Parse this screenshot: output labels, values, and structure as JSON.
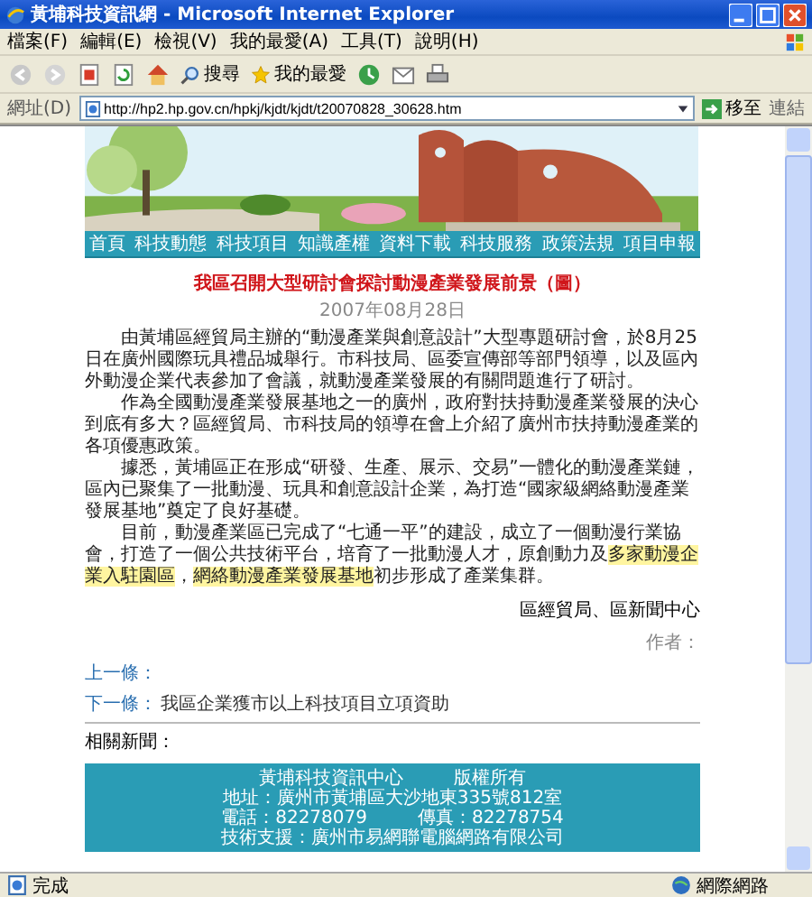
{
  "window": {
    "title": "黃埔科技資訊網 - Microsoft Internet Explorer"
  },
  "menu": [
    "檔案(F)",
    "編輯(E)",
    "檢視(V)",
    "我的最愛(A)",
    "工具(T)",
    "說明(H)"
  ],
  "toolbar": [
    {
      "kind": "back"
    },
    {
      "kind": "forward"
    },
    {
      "kind": "stop"
    },
    {
      "kind": "refresh"
    },
    {
      "kind": "home"
    },
    {
      "kind": "search",
      "label": "搜尋"
    },
    {
      "kind": "favorites",
      "label": "我的最愛"
    },
    {
      "kind": "history"
    },
    {
      "kind": "mail"
    },
    {
      "kind": "print"
    }
  ],
  "address": {
    "label": "網址(D)",
    "value": "http://hp2.hp.gov.cn/hpkj/kjdt/kjdt/t20070828_30628.htm",
    "go": "移至",
    "links": "連結"
  },
  "banner": {
    "kind": "picture"
  },
  "nav": [
    "首頁",
    "科技動態",
    "科技項目",
    "知識產權",
    "資料下載",
    "科技服務",
    "政策法規",
    "項目申報"
  ],
  "article": {
    "title": "我區召開大型研討會探討動漫產業發展前景（圖）",
    "date": "2007年08月28日",
    "paragraphs": [
      {
        "segments": [
          {
            "text": "由黃埔區經貿局主辦的“動漫產業與創意設計”大型專題研討會，於8月25日在廣州國際玩具禮品城舉行。市科技局、區委宣傳部等部門領導，以及區內外動漫企業代表參加了會議，就動漫產業發展的有關問題進行了研討。",
            "highlighted": false
          }
        ]
      },
      {
        "segments": [
          {
            "text": "作為全國動漫產業發展基地之一的廣州，政府對扶持動漫產業發展的決心到底有多大？區經貿局、市科技局的領導在會上介紹了廣州市扶持動漫產業的各項優惠政策。",
            "highlighted": false
          }
        ]
      },
      {
        "segments": [
          {
            "text": "據悉，黃埔區正在形成“研發、生產、展示、交易”一體化的動漫產業鏈，區內已聚集了一批動漫、玩具和創意設計企業，為打造“國家級網絡動漫產業發展基地”奠定了良好基礎。",
            "highlighted": false
          }
        ]
      },
      {
        "segments": [
          {
            "text": "目前，動漫產業區已完成了“七通一平”的建設，成立了一個動漫行業協會，打造了一個公共技術平台，培育了一批動漫人才，原創動力及",
            "highlighted": false
          },
          {
            "text": "多家動漫企業入駐園區",
            "highlighted": true
          },
          {
            "text": "，",
            "highlighted": false
          },
          {
            "text": "網絡動漫產業發展基地",
            "highlighted": true
          },
          {
            "text": "初步形成了產業集群。",
            "highlighted": false
          }
        ]
      }
    ],
    "source": "區經貿局、區新聞中心",
    "author": "作者：",
    "prev": {
      "label": "上一條："
    },
    "next": {
      "label": "下一條：",
      "title": "我區企業獲市以上科技項目立項資助"
    },
    "related": "相關新聞："
  },
  "footer": [
    [
      "黃埔科技資訊中心",
      "版權所有"
    ],
    [
      "地址：廣州市黃埔區大沙地東335號812室"
    ],
    [
      "電話：82278079",
      "傳真：82278754"
    ],
    [
      "技術支援：廣州市易網聯電腦網路有限公司"
    ]
  ],
  "status": {
    "text": "完成",
    "zone": "網際網路"
  }
}
